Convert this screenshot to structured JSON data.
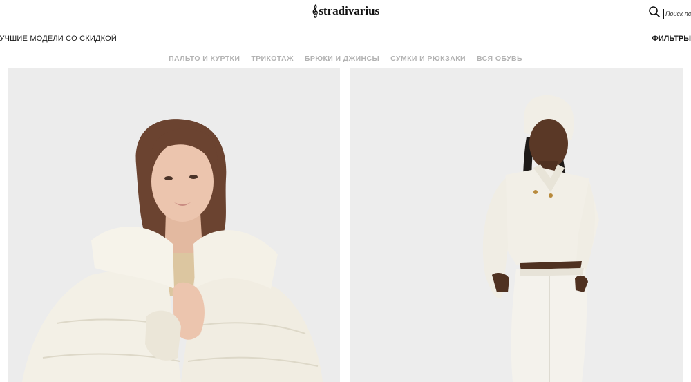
{
  "header": {
    "logo_text": "stradivarius",
    "search_placeholder": "Поиск по товарам"
  },
  "promo": {
    "left_text": "ЛУЧШИЕ МОДЕЛИ СО СКИДКОЙ",
    "right_text": "ФИЛЬТРЫ"
  },
  "category_nav": {
    "items": [
      {
        "label": "ПАЛЬТО И КУРТКИ"
      },
      {
        "label": "ТРИКОТАЖ"
      },
      {
        "label": "БРЮКИ И ДЖИНСЫ"
      },
      {
        "label": "СУМКИ И РЮКЗАКИ"
      },
      {
        "label": "ВСЯ ОБУВЬ"
      }
    ]
  },
  "products": [
    {
      "image": "model-cream-puffer-jacket"
    },
    {
      "image": "model-cream-knit-sweater-white-jeans"
    }
  ],
  "colors": {
    "text": "#1a1a1a",
    "nav_inactive": "#b3b3b3",
    "tile_background": "#ececec",
    "garment_cream": "#f3f0e6"
  }
}
